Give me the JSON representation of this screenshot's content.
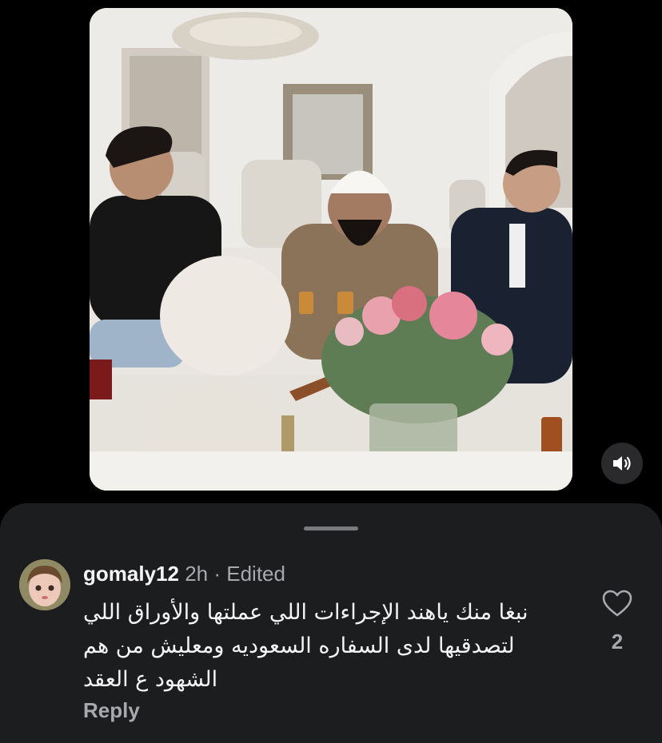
{
  "video": {
    "description_icon": "video-frame",
    "mute_icon": "speaker-muted-icon"
  },
  "comment": {
    "username": "gomaly12",
    "time": "2h",
    "separator": "·",
    "edited": "Edited",
    "text": "نبغا منك ياهند الإجراءات اللي عملتها والأوراق اللي لتصدقيها لدى السفاره السعوديه ومعليش من هم الشهود ع العقد",
    "reply_label": "Reply",
    "like_icon": "heart-outline-icon",
    "like_count": "2"
  },
  "colors": {
    "sheet_bg": "#1c1d1f",
    "muted_text": "#a8a8ad",
    "primary_text": "#f5f5f5"
  }
}
